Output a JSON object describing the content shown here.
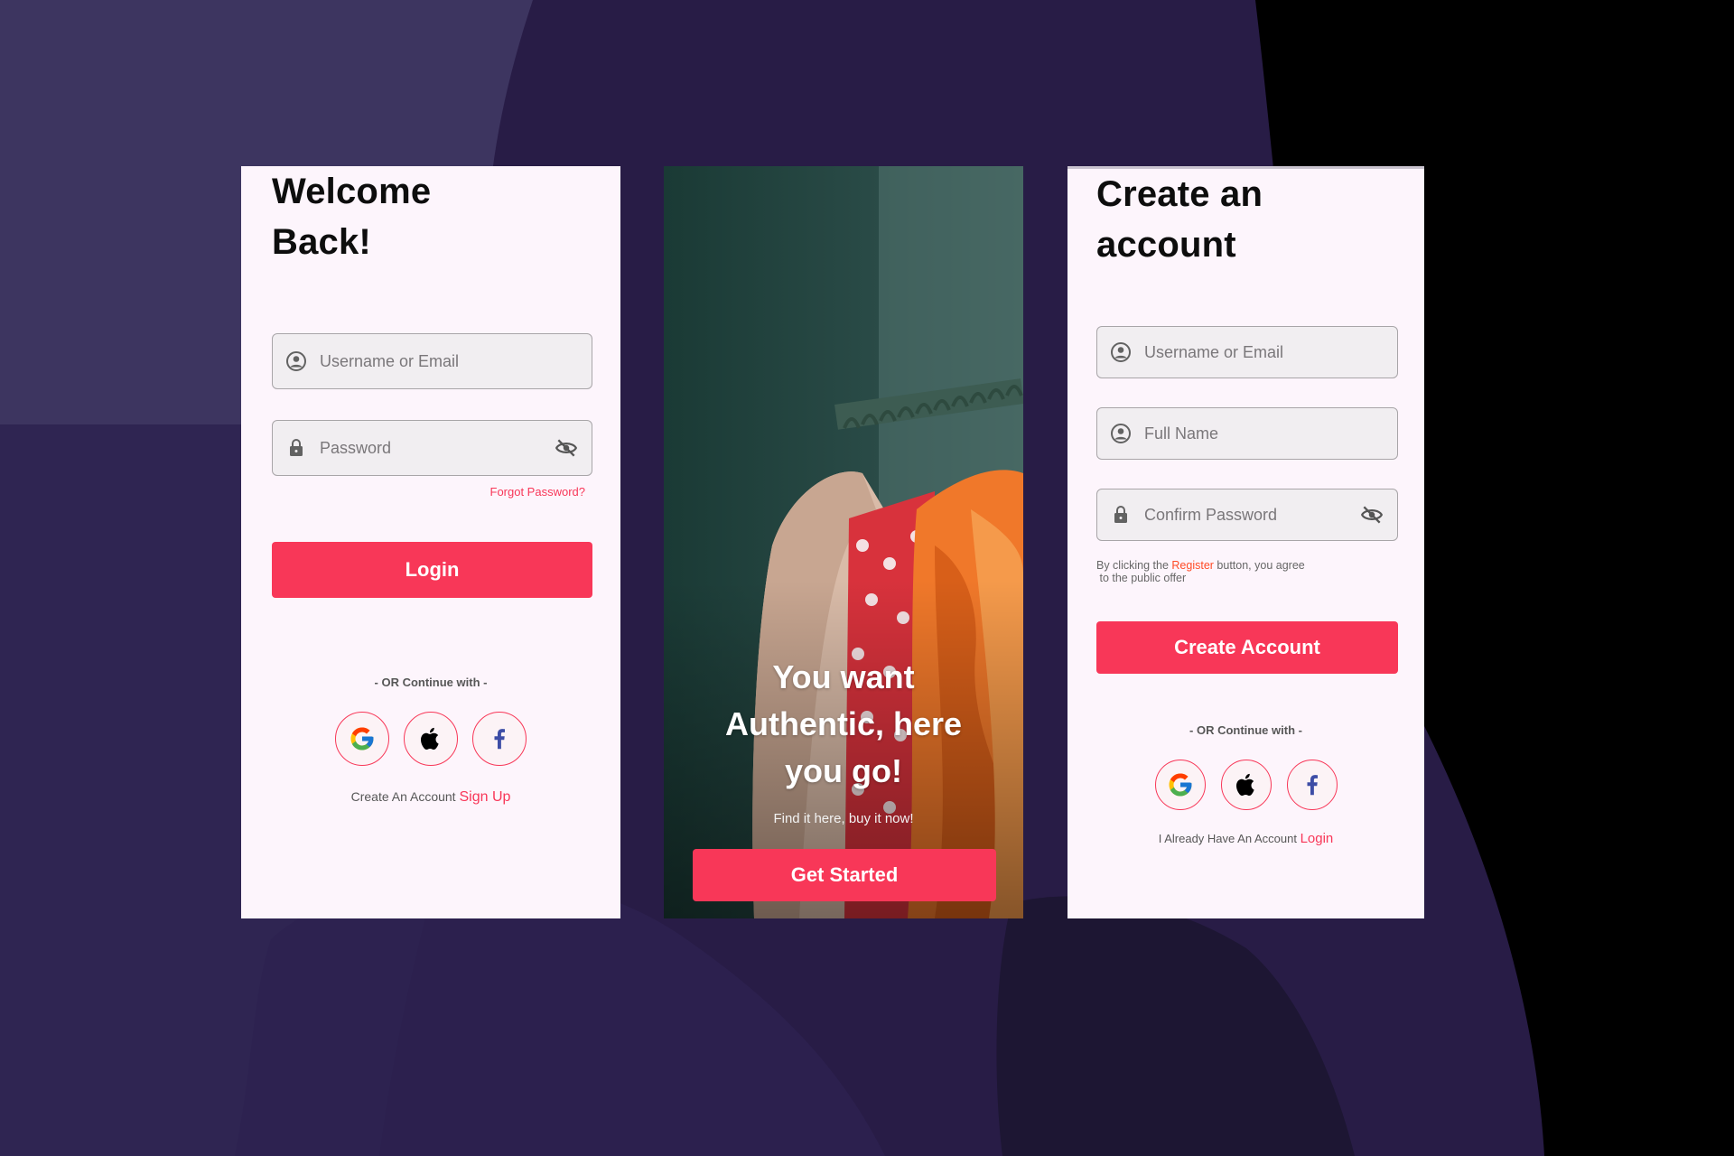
{
  "theme": {
    "accent": "#F83758",
    "background": "#241A3C",
    "card": "#FDF5FC"
  },
  "login": {
    "title_line1": "Welcome",
    "title_line2": "Back!",
    "username_placeholder": "Username or Email",
    "password_placeholder": "Password",
    "forgot_label": "Forgot Password?",
    "login_label": "Login",
    "or_label": "- OR Continue with -",
    "footer_text": "Create An Account",
    "footer_link": "Sign Up",
    "icons": [
      "user-icon",
      "lock-icon",
      "eye-off-icon",
      "google-icon",
      "apple-icon",
      "facebook-icon"
    ]
  },
  "onboard": {
    "hero_line1": "You want",
    "hero_line2": "Authentic, here",
    "hero_line3": "you go!",
    "sub": "Find it here, buy it now!",
    "cta_label": "Get Started"
  },
  "register": {
    "title_line1": "Create an",
    "title_line2": "account",
    "username_placeholder": "Username or Email",
    "fullname_placeholder": "Full Name",
    "confirm_placeholder": "Confirm Password",
    "terms_pre": "By clicking the",
    "terms_link": "Register",
    "terms_post": "button, you agree",
    "terms_line2": "to the public offer",
    "create_label": "Create Account",
    "or_label": "- OR Continue with -",
    "footer_text": "I Already Have An Account",
    "footer_link": "Login"
  }
}
